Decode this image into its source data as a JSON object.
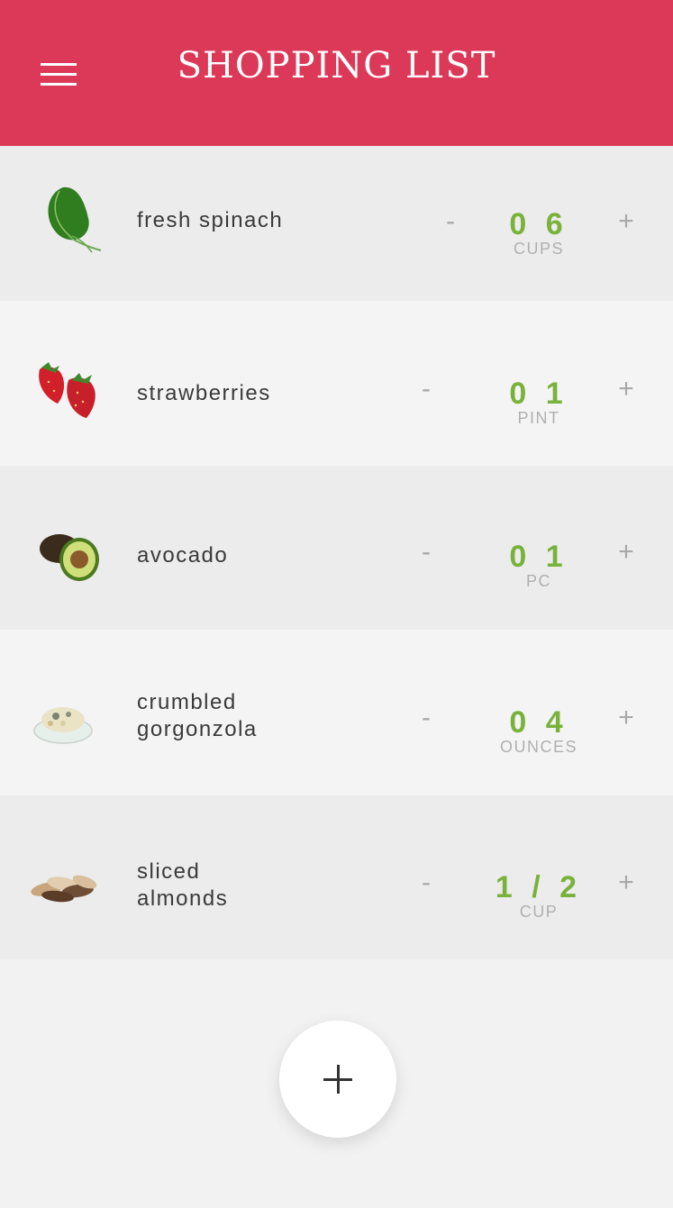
{
  "header": {
    "title": "SHOPPING LIST",
    "background": "#dc3958"
  },
  "items": [
    {
      "name": "fresh spinach",
      "quantity": "0 6",
      "unit": "CUPS",
      "icon": "spinach-icon"
    },
    {
      "name": "strawberries",
      "quantity": "0 1",
      "unit": "PINT",
      "icon": "strawberry-icon"
    },
    {
      "name": "avocado",
      "quantity": "0 1",
      "unit": "PC",
      "icon": "avocado-icon"
    },
    {
      "name_lines": [
        "crumbled",
        "gorgonzola"
      ],
      "quantity": "0 4",
      "unit": "OUNCES",
      "icon": "gorgonzola-icon"
    },
    {
      "name_lines": [
        "sliced",
        "almonds"
      ],
      "quantity": "1 / 2",
      "unit": "CUP",
      "icon": "almond-icon"
    }
  ],
  "controls": {
    "decrement": "-",
    "increment": "+"
  },
  "accent_color": "#79b23a"
}
